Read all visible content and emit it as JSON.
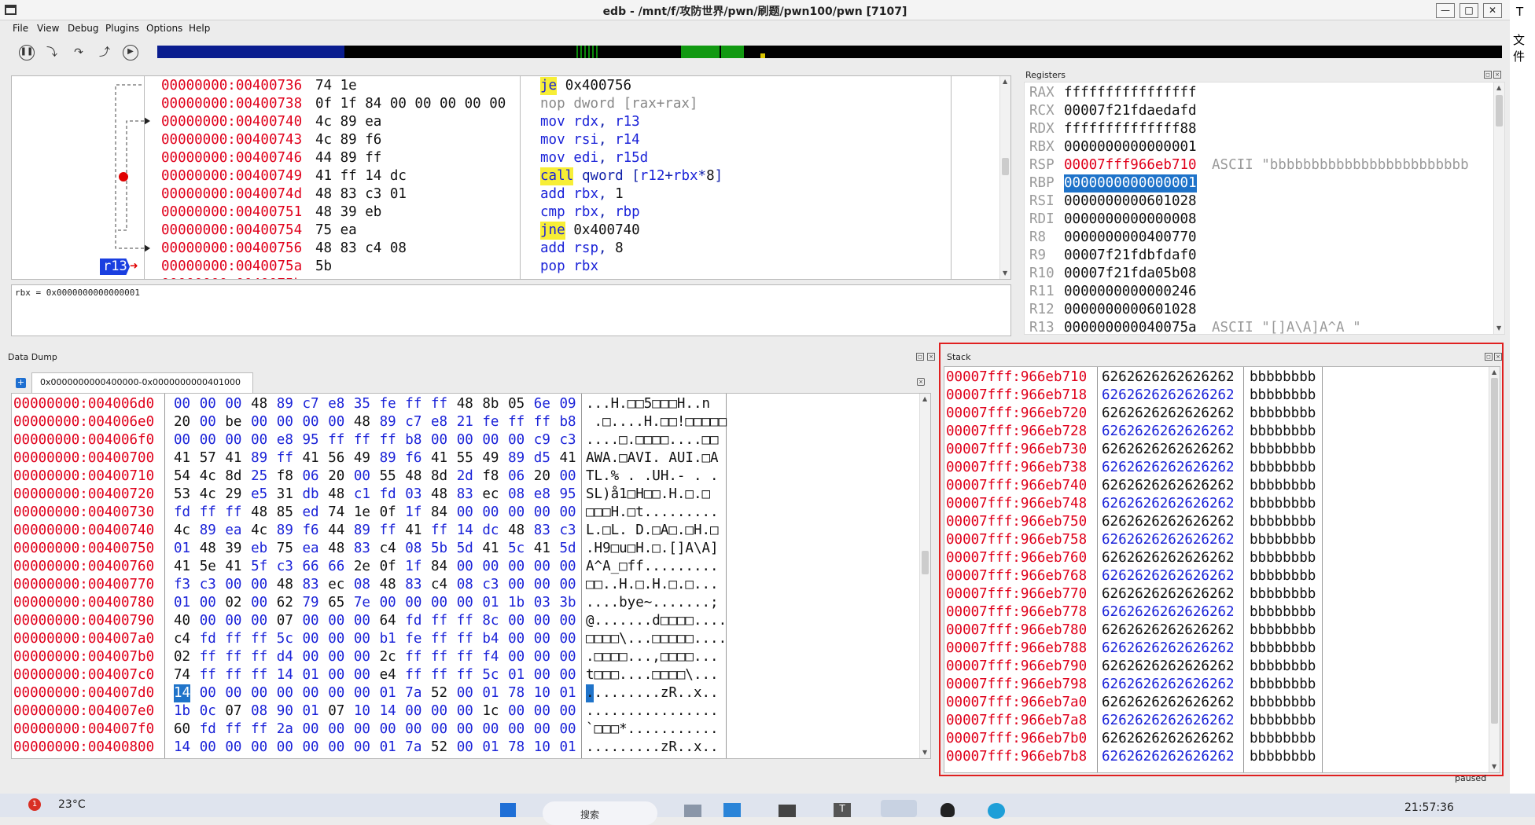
{
  "window": {
    "title": "edb - /mnt/f/攻防世界/pwn/刷题/pwn100/pwn [7107]",
    "btn_min": "—",
    "btn_max": "□",
    "btn_close": "✕"
  },
  "menu": [
    "File",
    "View",
    "Debug",
    "Plugins",
    "Options",
    "Help"
  ],
  "toolbar_icons": [
    "pause-icon",
    "step-into-icon",
    "step-over-icon",
    "step-out-icon",
    "run-icon"
  ],
  "disasm": {
    "rows": [
      {
        "addr": "00000000:00400736",
        "bytes": "74 1e",
        "mn": "je",
        "ops": "0x400756",
        "hl": true
      },
      {
        "addr": "00000000:00400738",
        "bytes": "0f 1f 84 00 00 00 00 00",
        "mn": "nop",
        "ops": "dword [rax+rax]",
        "nop": true
      },
      {
        "addr": "00000000:00400740",
        "bytes": "4c 89 ea",
        "mn": "mov",
        "ops": "rdx, r13"
      },
      {
        "addr": "00000000:00400743",
        "bytes": "4c 89 f6",
        "mn": "mov",
        "ops": "rsi, r14"
      },
      {
        "addr": "00000000:00400746",
        "bytes": "44 89 ff",
        "mn": "mov",
        "ops": "edi, r15d"
      },
      {
        "addr": "00000000:00400749",
        "bytes": "41 ff 14 dc",
        "mn": "call",
        "ops": "qword [r12+rbx*8]",
        "hl": true,
        "bp": true
      },
      {
        "addr": "00000000:0040074d",
        "bytes": "48 83 c3 01",
        "mn": "add",
        "ops": "rbx, 1"
      },
      {
        "addr": "00000000:00400751",
        "bytes": "48 39 eb",
        "mn": "cmp",
        "ops": "rbx, rbp"
      },
      {
        "addr": "00000000:00400754",
        "bytes": "75 ea",
        "mn": "jne",
        "ops": "0x400740",
        "hl": true
      },
      {
        "addr": "00000000:00400756",
        "bytes": "48 83 c4 08",
        "mn": "add",
        "ops": "rsp, 8"
      },
      {
        "addr": "00000000:0040075a",
        "bytes": "5b",
        "mn": "pop",
        "ops": "rbx",
        "cur": true
      }
    ],
    "cur_label": "r13",
    "status": "rbx = 0x0000000000000001"
  },
  "registers": {
    "title": "Registers",
    "rows": [
      {
        "n": "RAX",
        "v": "ffffffffffffffff",
        "c": ""
      },
      {
        "n": "RCX",
        "v": "00007f21fdaedafd",
        "c": ""
      },
      {
        "n": "RDX",
        "v": "ffffffffffffff88",
        "c": ""
      },
      {
        "n": "RBX",
        "v": "0000000000000001",
        "c": ""
      },
      {
        "n": "RSP",
        "v": "00007fff966eb710",
        "c": "ASCII \"bbbbbbbbbbbbbbbbbbbbbbbb",
        "red": true
      },
      {
        "n": "RBP",
        "v": "0000000000000001",
        "c": "",
        "sel": true
      },
      {
        "n": "RSI",
        "v": "0000000000601028",
        "c": ""
      },
      {
        "n": "RDI",
        "v": "0000000000000008",
        "c": ""
      },
      {
        "n": "R8",
        "v": "0000000000400770",
        "c": ""
      },
      {
        "n": "R9",
        "v": "00007f21fdbfdaf0",
        "c": ""
      },
      {
        "n": "R10",
        "v": "00007f21fda05b08",
        "c": ""
      },
      {
        "n": "R11",
        "v": "0000000000000246",
        "c": ""
      },
      {
        "n": "R12",
        "v": "0000000000601028",
        "c": ""
      },
      {
        "n": "R13",
        "v": "000000000040075a",
        "c": "ASCII \"[]A\\A]A^A_\""
      }
    ]
  },
  "data_dump": {
    "title": "Data Dump",
    "tab": "0x0000000000400000-0x0000000000401000",
    "rows": [
      {
        "a": "00000000:004006d0",
        "b": "00 00 00 48 89 c7 e8 35 fe ff ff 48 8b 05 6e 09",
        "t": "...H.□□5□□□H..n"
      },
      {
        "a": "00000000:004006e0",
        "b": "20 00 be 00 00 00 00 48 89 c7 e8 21 fe ff ff b8",
        "t": " .□....H.□□!□□□□□"
      },
      {
        "a": "00000000:004006f0",
        "b": "00 00 00 00 e8 95 ff ff ff b8 00 00 00 00 c9 c3",
        "t": "....□.□□□□....□□"
      },
      {
        "a": "00000000:00400700",
        "b": "41 57 41 89 ff 41 56 49 89 f6 41 55 49 89 d5 41",
        "t": "AWA.□AVI. AUI.□A"
      },
      {
        "a": "00000000:00400710",
        "b": "54 4c 8d 25 f8 06 20 00 55 48 8d 2d f8 06 20 00",
        "t": "TL.% . .UH.- . ."
      },
      {
        "a": "00000000:00400720",
        "b": "53 4c 29 e5 31 db 48 c1 fd 03 48 83 ec 08 e8 95",
        "t": "SL)å1□H□□.H.□.□"
      },
      {
        "a": "00000000:00400730",
        "b": "fd ff ff 48 85 ed 74 1e 0f 1f 84 00 00 00 00 00",
        "t": "□□□H.□t........."
      },
      {
        "a": "00000000:00400740",
        "b": "4c 89 ea 4c 89 f6 44 89 ff 41 ff 14 dc 48 83 c3",
        "t": "L.□L. D.□A□.□H.□"
      },
      {
        "a": "00000000:00400750",
        "b": "01 48 39 eb 75 ea 48 83 c4 08 5b 5d 41 5c 41 5d",
        "t": ".H9□u□H.□.[]A\\A]"
      },
      {
        "a": "00000000:00400760",
        "b": "41 5e 41 5f c3 66 66 2e 0f 1f 84 00 00 00 00 00",
        "t": "A^A_□ff........."
      },
      {
        "a": "00000000:00400770",
        "b": "f3 c3 00 00 48 83 ec 08 48 83 c4 08 c3 00 00 00",
        "t": "□□..H.□.H.□.□..."
      },
      {
        "a": "00000000:00400780",
        "b": "01 00 02 00 62 79 65 7e 00 00 00 00 01 1b 03 3b",
        "t": "....bye~.......;"
      },
      {
        "a": "00000000:00400790",
        "b": "40 00 00 00 07 00 00 00 64 fd ff ff 8c 00 00 00",
        "t": "@.......d□□□□...."
      },
      {
        "a": "00000000:004007a0",
        "b": "c4 fd ff ff 5c 00 00 00 b1 fe ff ff b4 00 00 00",
        "t": "□□□□\\...□□□□□...."
      },
      {
        "a": "00000000:004007b0",
        "b": "02 ff ff ff d4 00 00 00 2c ff ff ff f4 00 00 00",
        "t": ".□□□□...,□□□□..."
      },
      {
        "a": "00000000:004007c0",
        "b": "74 ff ff ff 14 01 00 00 e4 ff ff ff 5c 01 00 00",
        "t": "t□□□....□□□□\\..."
      },
      {
        "a": "00000000:004007d0",
        "b": "14 00 00 00 00 00 00 00 01 7a 52 00 01 78 10 01",
        "t": ".........zR..x..",
        "sel": true
      },
      {
        "a": "00000000:004007e0",
        "b": "1b 0c 07 08 90 01 07 10 14 00 00 00 1c 00 00 00",
        "t": "................"
      },
      {
        "a": "00000000:004007f0",
        "b": "60 fd ff ff 2a 00 00 00 00 00 00 00 00 00 00 00",
        "t": "`□□□*..........."
      },
      {
        "a": "00000000:00400800",
        "b": "14 00 00 00 00 00 00 00 01 7a 52 00 01 78 10 01",
        "t": ".........zR..x.."
      }
    ]
  },
  "stack": {
    "title": "Stack",
    "rows": [
      {
        "a": "00007fff:966eb710",
        "v": "6262626262626262",
        "s": "bbbbbbbb"
      },
      {
        "a": "00007fff:966eb718",
        "v": "6262626262626262",
        "s": "bbbbbbbb"
      },
      {
        "a": "00007fff:966eb720",
        "v": "6262626262626262",
        "s": "bbbbbbbb"
      },
      {
        "a": "00007fff:966eb728",
        "v": "6262626262626262",
        "s": "bbbbbbbb"
      },
      {
        "a": "00007fff:966eb730",
        "v": "6262626262626262",
        "s": "bbbbbbbb"
      },
      {
        "a": "00007fff:966eb738",
        "v": "6262626262626262",
        "s": "bbbbbbbb"
      },
      {
        "a": "00007fff:966eb740",
        "v": "6262626262626262",
        "s": "bbbbbbbb"
      },
      {
        "a": "00007fff:966eb748",
        "v": "6262626262626262",
        "s": "bbbbbbbb"
      },
      {
        "a": "00007fff:966eb750",
        "v": "6262626262626262",
        "s": "bbbbbbbb"
      },
      {
        "a": "00007fff:966eb758",
        "v": "6262626262626262",
        "s": "bbbbbbbb"
      },
      {
        "a": "00007fff:966eb760",
        "v": "6262626262626262",
        "s": "bbbbbbbb"
      },
      {
        "a": "00007fff:966eb768",
        "v": "6262626262626262",
        "s": "bbbbbbbb"
      },
      {
        "a": "00007fff:966eb770",
        "v": "6262626262626262",
        "s": "bbbbbbbb"
      },
      {
        "a": "00007fff:966eb778",
        "v": "6262626262626262",
        "s": "bbbbbbbb"
      },
      {
        "a": "00007fff:966eb780",
        "v": "6262626262626262",
        "s": "bbbbbbbb"
      },
      {
        "a": "00007fff:966eb788",
        "v": "6262626262626262",
        "s": "bbbbbbbb"
      },
      {
        "a": "00007fff:966eb790",
        "v": "6262626262626262",
        "s": "bbbbbbbb"
      },
      {
        "a": "00007fff:966eb798",
        "v": "6262626262626262",
        "s": "bbbbbbbb"
      },
      {
        "a": "00007fff:966eb7a0",
        "v": "6262626262626262",
        "s": "bbbbbbbb"
      },
      {
        "a": "00007fff:966eb7a8",
        "v": "6262626262626262",
        "s": "bbbbbbbb"
      },
      {
        "a": "00007fff:966eb7b0",
        "v": "6262626262626262",
        "s": "bbbbbbbb"
      },
      {
        "a": "00007fff:966eb7b8",
        "v": "6262626262626262",
        "s": "bbbbbbbb"
      }
    ]
  },
  "status": "paused",
  "taskbar": {
    "temp": "23°C",
    "badge": "1",
    "search": "搜索",
    "time": "21:57:36"
  },
  "right_strip": {
    "t1": "T",
    "t2": "文件"
  },
  "colors": {
    "addr": "#e0001b",
    "mnemonic": "#1a22d8",
    "highlight": "#f7ee36",
    "selection": "#1f73c9",
    "stack_border": "#e02020"
  }
}
